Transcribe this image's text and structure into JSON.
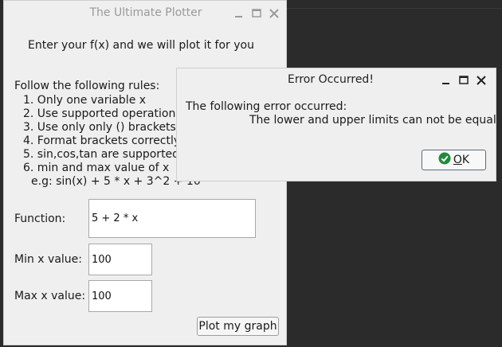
{
  "main_window": {
    "title": "The Ultimate Plotter",
    "heading": "Enter your f(x) and we will plot it for you",
    "rules_title": "Follow the following rules:",
    "rules": [
      "1. Only one variable x",
      "2. Use supported operations",
      "3. Use only only () brackets",
      "4. Format brackets correctly",
      "5. sin,cos,tan are supported",
      "6. min and max value of x"
    ],
    "example": "e.g: sin(x) + 5 * x + 3^2  + 10",
    "function_label": "Function:",
    "function_value": "5 + 2 * x",
    "min_label": "Min x value:",
    "min_value": "100",
    "max_label": "Max x value:",
    "max_value": "100",
    "plot_button": "Plot my graph"
  },
  "error_dialog": {
    "title": "Error Occurred!",
    "line1": "The following error occurred:",
    "line2": "The lower and upper limits can not be equal",
    "ok_mnemonic": "O",
    "ok_rest": "K"
  },
  "colors": {
    "check_icon": "#1f8a3b",
    "background": "#2b2b2b",
    "window": "#efefef"
  }
}
